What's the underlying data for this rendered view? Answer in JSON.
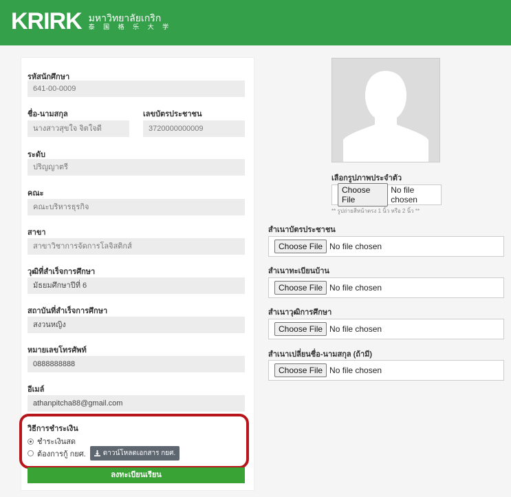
{
  "brand": {
    "logo_text": "KRIRK",
    "name_th": "มหาวิทยาลัยเกริก",
    "name_cn": "泰 国 格 乐 大 学"
  },
  "form": {
    "student_id": {
      "label": "รหัสนักศึกษา",
      "value": "641-00-0009"
    },
    "full_name": {
      "label": "ชื่อ-นามสกุล",
      "value": "นางสาวสุขใจ จิตใจดี"
    },
    "national_id": {
      "label": "เลขบัตรประชาชน",
      "value": "3720000000009"
    },
    "level": {
      "label": "ระดับ",
      "value": "ปริญญาตรี"
    },
    "faculty": {
      "label": "คณะ",
      "value": "คณะบริหารธุรกิจ"
    },
    "major": {
      "label": "สาขา",
      "value": "สาขาวิชาการจัดการโลจิสติกส์"
    },
    "education": {
      "label": "วุฒิที่สำเร็จการศึกษา",
      "value": "มัธยมศึกษาปีที่ 6"
    },
    "institution": {
      "label": "สถาบันที่สำเร็จการศึกษา",
      "value": "สงวนหญิง"
    },
    "phone": {
      "label": "หมายเลขโทรศัพท์",
      "value": "0888888888"
    },
    "email": {
      "label": "อีเมล์",
      "value": "athanpitcha88@gmail.com"
    }
  },
  "payment": {
    "label": "วิธีการชำระเงิน",
    "options": [
      {
        "label": "ชำระเงินสด",
        "selected": true
      },
      {
        "label": "ต้องการกู้ กยศ.",
        "selected": false
      }
    ],
    "download_label": "ดาวน์โหลดเอกสาร กยศ."
  },
  "submit_label": "ลงทะเบียนเรียน",
  "uploads": {
    "photo": {
      "label": "เลือกรูปภาพประจำตัว",
      "button": "Choose File",
      "status": "No file chosen",
      "hint": "** รูปถ่ายสีหน้าตรง 1 นิ้ว หรือ 2 นิ้ว **"
    },
    "id_card": {
      "label": "สำเนาบัตรประชาชน",
      "button": "Choose File",
      "status": "No file chosen"
    },
    "house_reg": {
      "label": "สำเนาทะเบียนบ้าน",
      "button": "Choose File",
      "status": "No file chosen"
    },
    "transcript": {
      "label": "สำเนาวุฒิการศึกษา",
      "button": "Choose File",
      "status": "No file chosen"
    },
    "name_change": {
      "label": "สำเนาเปลี่ยนชื่อ-นามสกุล (ถ้ามี)",
      "button": "Choose File",
      "status": "No file chosen"
    }
  },
  "colors": {
    "header": "#34a14a",
    "submit": "#3aa335",
    "highlight": "#b8151b"
  }
}
